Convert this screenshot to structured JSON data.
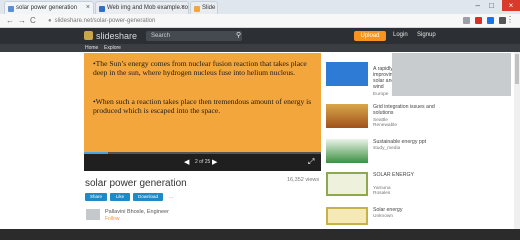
{
  "browser": {
    "tabs": [
      {
        "label": "solar power generation",
        "active": true
      },
      {
        "label": "Web img and Mob example.co",
        "active": false
      },
      {
        "label": "Slide",
        "active": false
      }
    ],
    "url": "slideshare.net/solar-power-generation"
  },
  "site": {
    "search_placeholder": "Search",
    "upload_label": "Upload",
    "login_label": "Login",
    "signup_label": "Signup",
    "subnav": [
      "Home",
      "Explore"
    ]
  },
  "slide": {
    "paragraphs": [
      "•The Sun’s energy comes from nuclear fusion reaction that takes place deep in the sun, where hydrogen nucleus fuse into helium nucleus.",
      "•When such a reaction takes place then tremendous amount of energy is produced which is escaped into the space."
    ],
    "page_info": "2 of 25",
    "progress": 0.1
  },
  "presentation": {
    "title": "solar power generation",
    "views": "16,352 views",
    "share_label": "Share",
    "like_label": "Like",
    "download_label": "Download",
    "more_label": "...",
    "author": "Pallavini Bhosle, Engineer",
    "follow_label": "Follow"
  },
  "related": [
    {
      "title": "A rapidly improving solar and wind",
      "author": "Europe",
      "thumb_color": "#2e7bd6"
    },
    {
      "title": "Grid integration issues and solutions",
      "author": "Seattle Renewable",
      "thumb_color": "#c9861e"
    },
    {
      "title": "Sustainable energy ppt",
      "author": "study_media",
      "thumb_color": "#3b8f41"
    },
    {
      "title": "SOLAR ENERGY",
      "author": "Yamuna Rosales",
      "thumb_color": "#8ea851"
    },
    {
      "title": "Solar energy",
      "author": "Unknown",
      "thumb_color": "#c7b24a"
    }
  ],
  "colors": {
    "accent": "#f7941d",
    "primary_button": "#1f8ac5",
    "slide_bg": "#f3a63c"
  }
}
